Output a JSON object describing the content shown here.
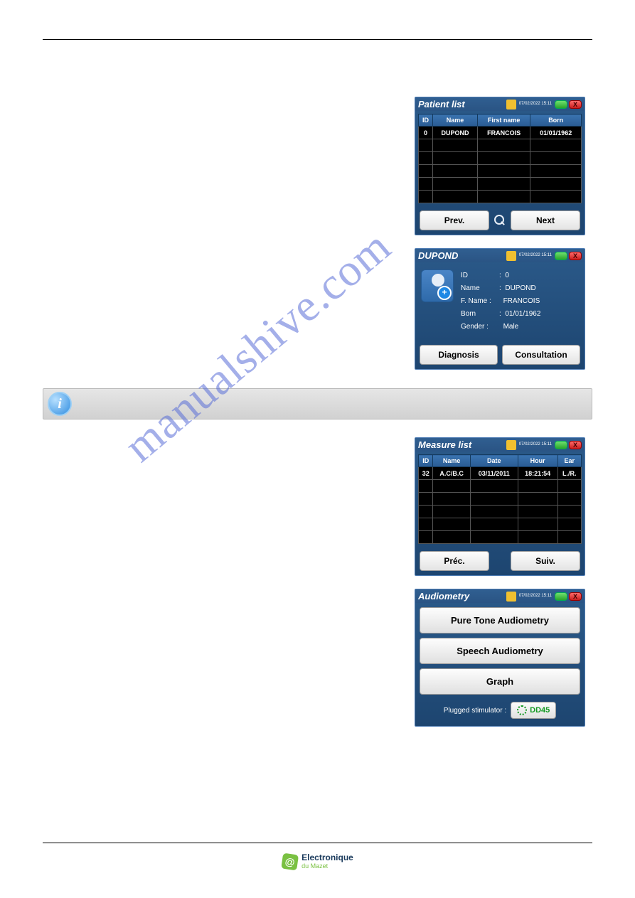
{
  "watermark": "manualshive.com",
  "header_time": "07/02/2022\n15:11",
  "panels": {
    "patientList": {
      "title": "Patient list",
      "cols": [
        "ID",
        "Name",
        "First name",
        "Born"
      ],
      "rows": [
        [
          "0",
          "DUPOND",
          "FRANCOIS",
          "01/01/1962"
        ],
        [
          "",
          "",
          "",
          ""
        ],
        [
          "",
          "",
          "",
          ""
        ],
        [
          "",
          "",
          "",
          ""
        ],
        [
          "",
          "",
          "",
          ""
        ],
        [
          "",
          "",
          "",
          ""
        ]
      ],
      "prev": "Prev.",
      "next": "Next"
    },
    "patientDetail": {
      "title": "DUPOND",
      "fields": {
        "id_lbl": "ID",
        "id": "0",
        "name_lbl": "Name",
        "name": "DUPOND",
        "fname_lbl": "F. Name :",
        "fname": "FRANCOIS",
        "born_lbl": "Born",
        "born": "01/01/1962",
        "gender_lbl": "Gender :",
        "gender": "Male"
      },
      "diag": "Diagnosis",
      "consult": "Consultation"
    },
    "measureList": {
      "title": "Measure list",
      "cols": [
        "ID",
        "Name",
        "Date",
        "Hour",
        "Ear"
      ],
      "rows": [
        [
          "32",
          "A.C/B.C",
          "03/11/2011",
          "18:21:54",
          "L./R."
        ],
        [
          "",
          "",
          "",
          "",
          ""
        ],
        [
          "",
          "",
          "",
          "",
          ""
        ],
        [
          "",
          "",
          "",
          "",
          ""
        ],
        [
          "",
          "",
          "",
          "",
          ""
        ],
        [
          "",
          "",
          "",
          "",
          ""
        ]
      ],
      "prev": "Préc.",
      "next": "Suiv."
    },
    "audiometry": {
      "title": "Audiometry",
      "b1": "Pure Tone Audiometry",
      "b2": "Speech Audiometry",
      "b3": "Graph",
      "plugged_lbl": "Plugged stimulator :",
      "plugged_val": "DD45"
    }
  },
  "footer": {
    "brand_top": "Electronique",
    "brand_bot": "du Mazet"
  }
}
